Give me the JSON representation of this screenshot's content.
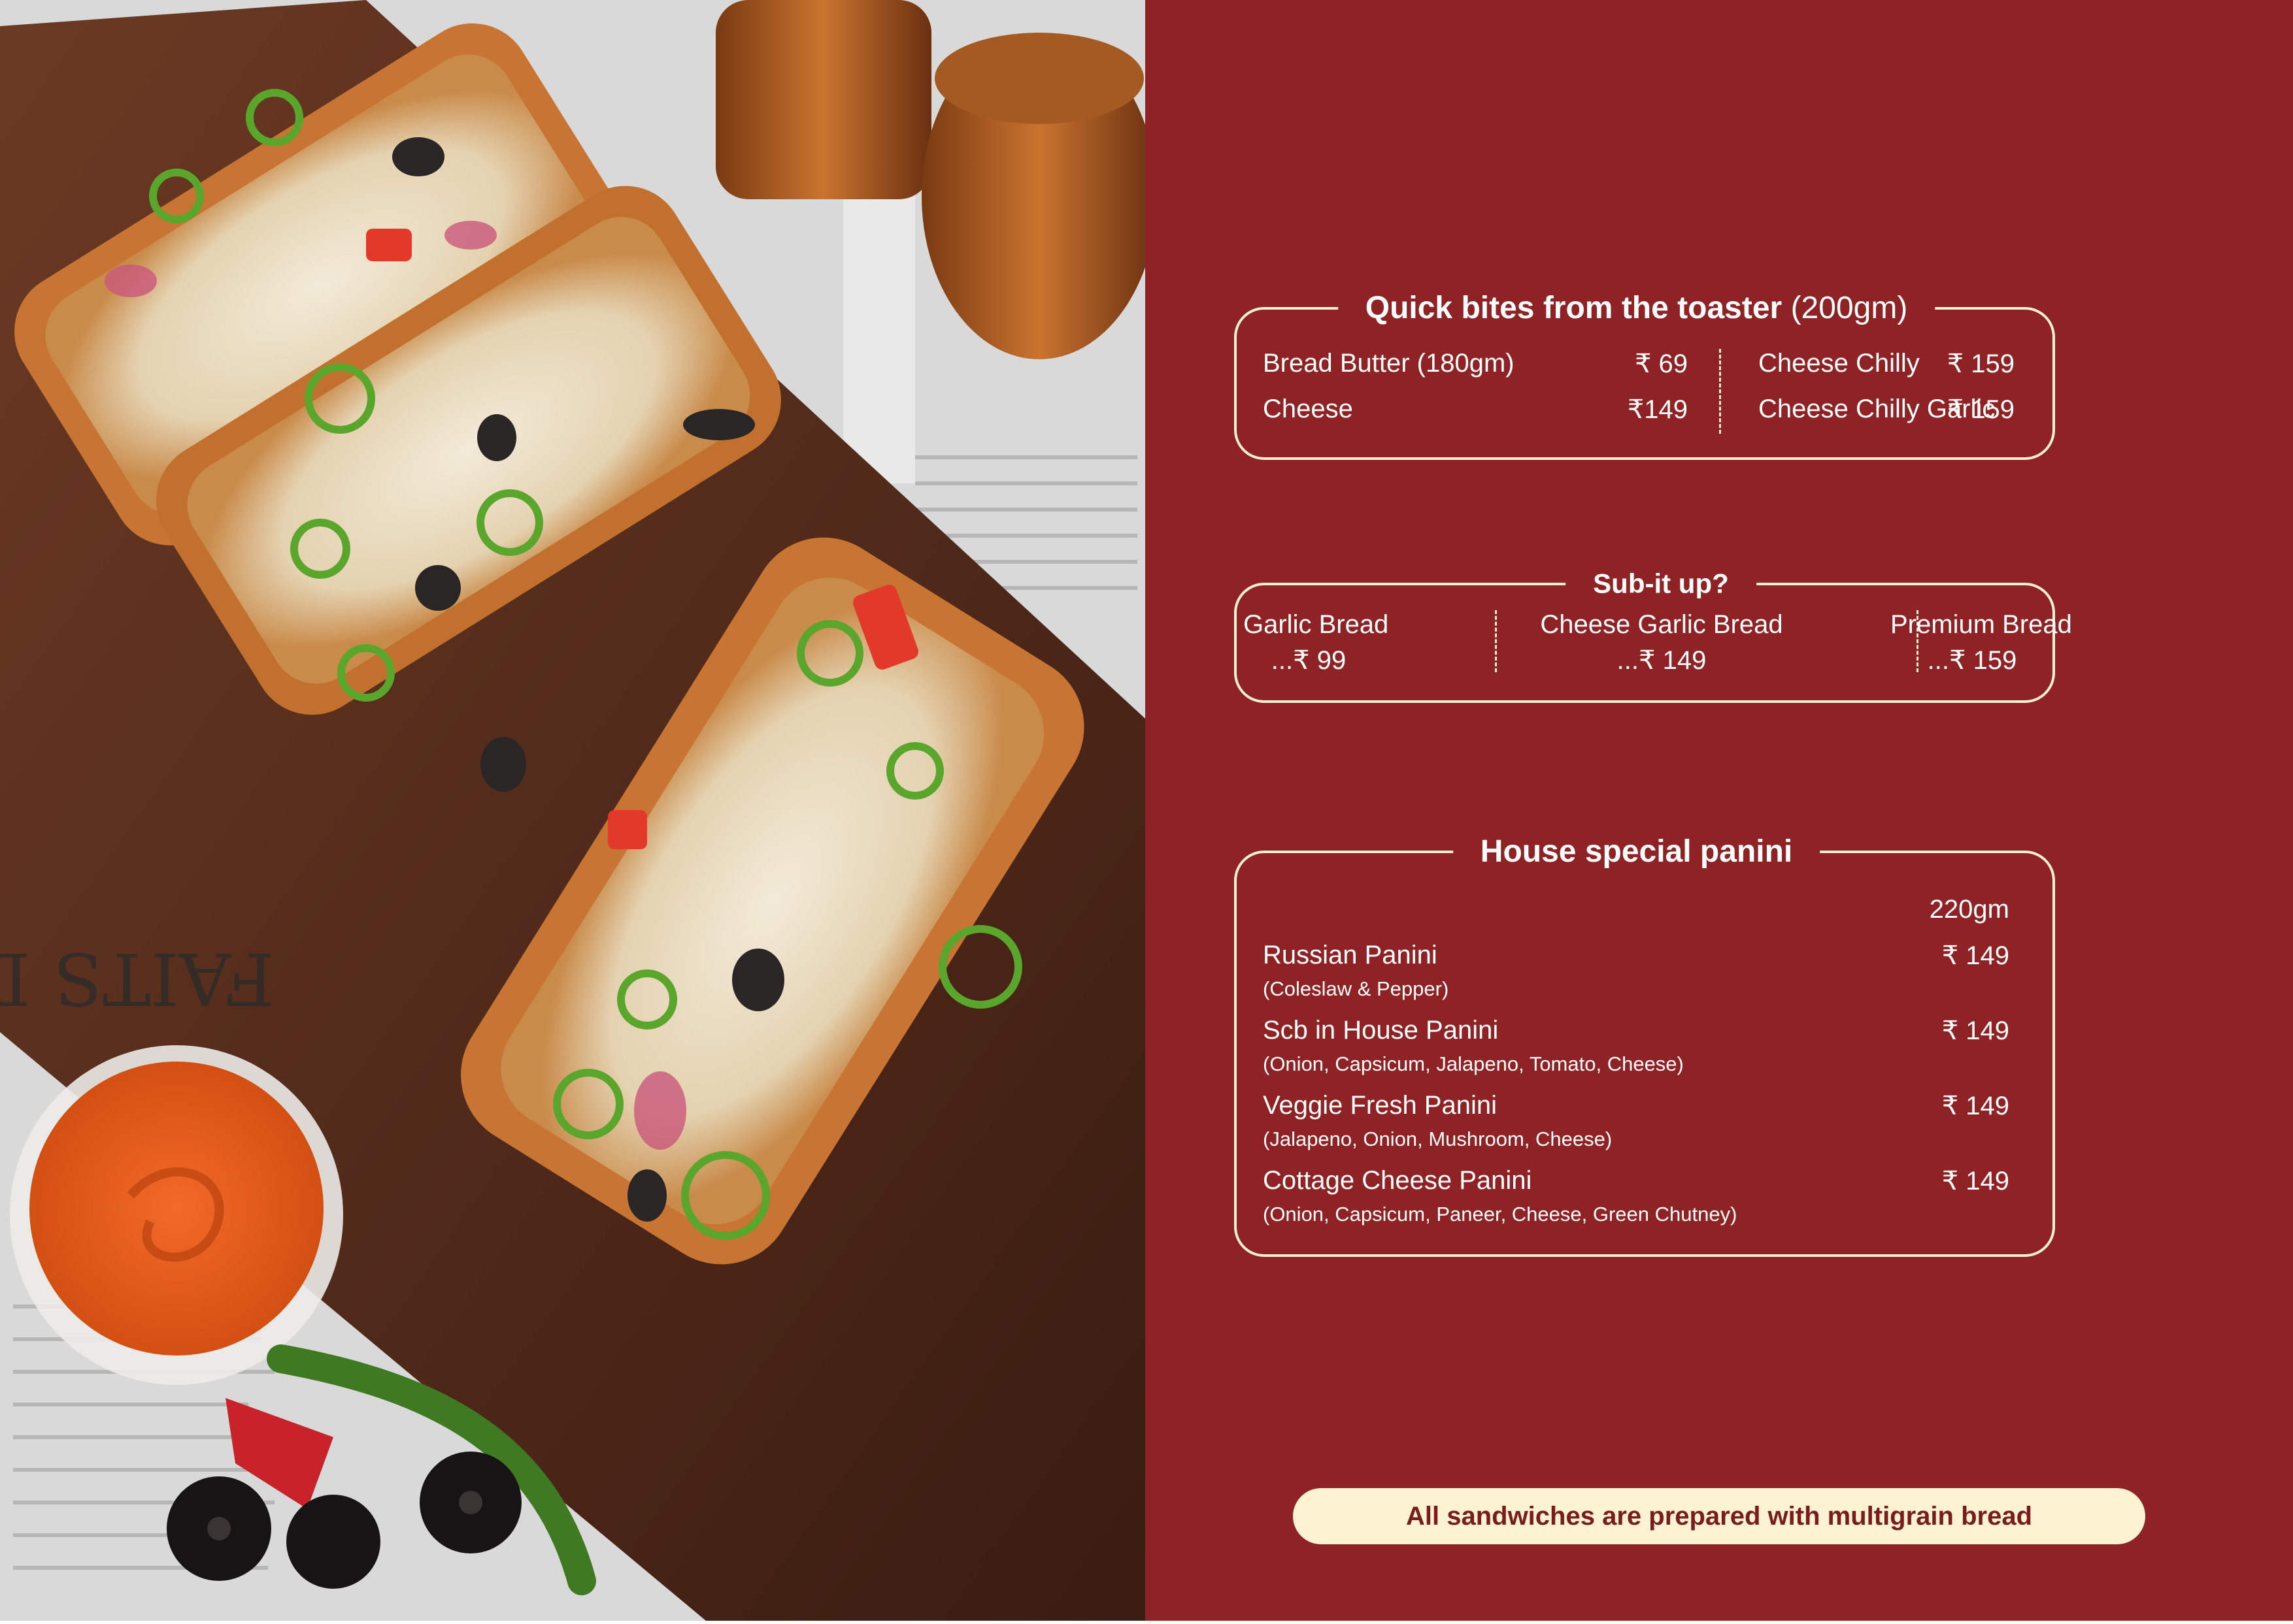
{
  "colors": {
    "panel": "#8f2224",
    "line": "#fbf0d4",
    "text": "#ffffff",
    "note_bg": "#fdf3d2",
    "note_text": "#7a1c1c"
  },
  "photo": {
    "description_icon": "garlic-bread-photo"
  },
  "quick_bites": {
    "title_bold": "Quick bites from the toaster",
    "title_light": "(200gm)",
    "items": [
      {
        "name": "Bread Butter (180gm)",
        "price": "₹ 69"
      },
      {
        "name": "Cheese",
        "price": "₹149"
      },
      {
        "name": "Cheese Chilly",
        "price": "₹ 159"
      },
      {
        "name": "Cheese Chilly Garlic",
        "price": "₹ 159"
      }
    ]
  },
  "sub_it_up": {
    "title": "Sub-it up?",
    "items": [
      {
        "name": "Garlic Bread",
        "price": "...₹ 99"
      },
      {
        "name": "Cheese Garlic Bread",
        "price": "...₹ 149"
      },
      {
        "name": "Premium Bread",
        "price": "...₹ 159"
      }
    ]
  },
  "panini": {
    "title": "House special panini",
    "weight": "220gm",
    "items": [
      {
        "name": "Russian Panini",
        "desc": "(Coleslaw & Pepper)",
        "price": "₹ 149"
      },
      {
        "name": "Scb in House Panini",
        "desc": "(Onion, Capsicum, Jalapeno, Tomato, Cheese)",
        "price": "₹ 149"
      },
      {
        "name": "Veggie Fresh Panini",
        "desc": "(Jalapeno, Onion, Mushroom, Cheese)",
        "price": "₹ 149"
      },
      {
        "name": "Cottage Cheese Panini",
        "desc": "(Onion, Capsicum, Paneer, Cheese, Green Chutney)",
        "price": "₹ 149"
      }
    ]
  },
  "note": "All sandwiches are prepared with multigrain bread"
}
